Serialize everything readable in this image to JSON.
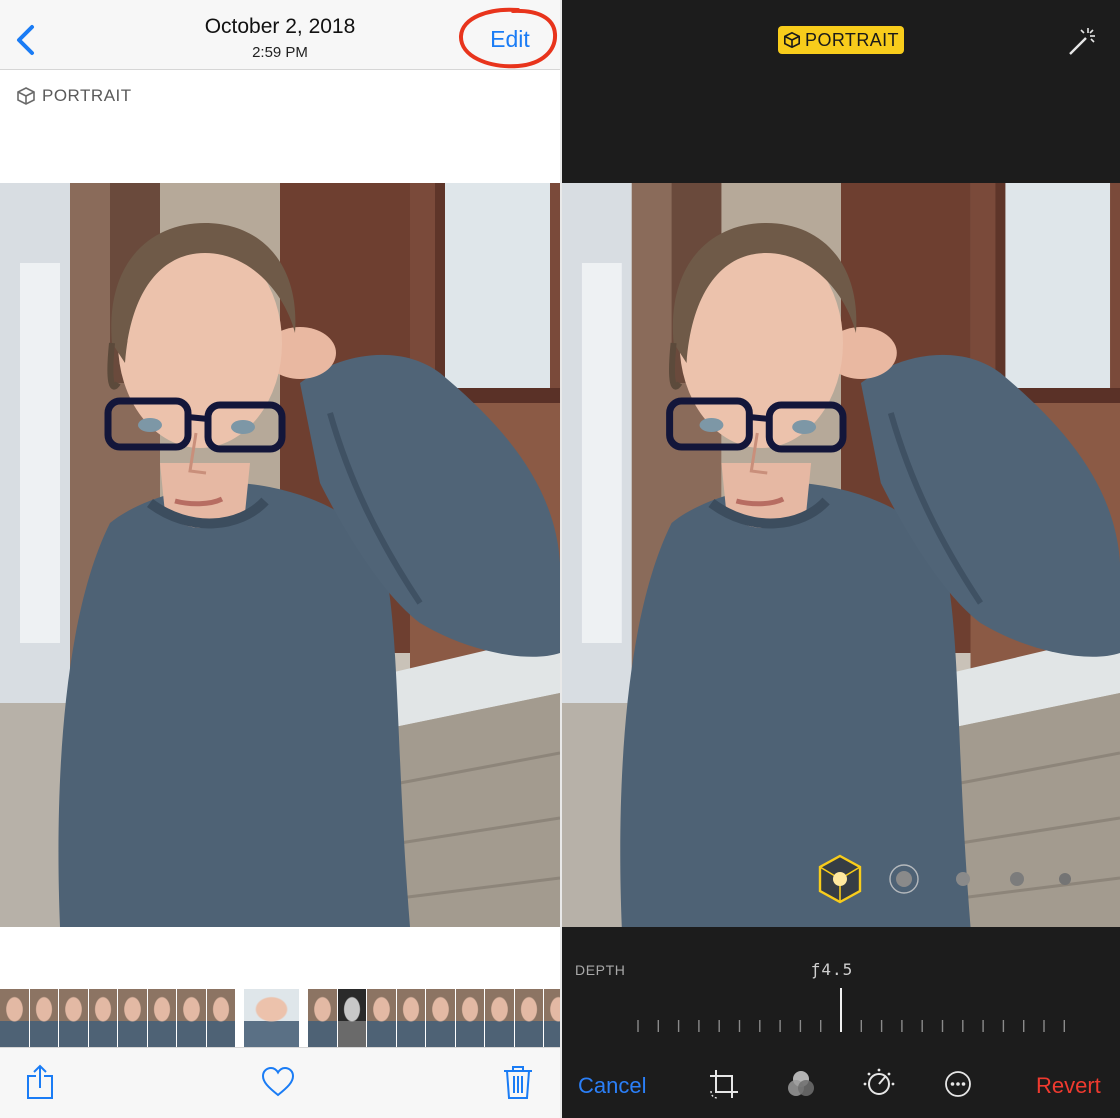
{
  "left_pane": {
    "header": {
      "date": "October 2, 2018",
      "time": "2:59 PM",
      "edit_label": "Edit",
      "accent_color": "#1a7cf5",
      "annotation_color": "#e8341c"
    },
    "portrait_label": "PORTRAIT",
    "filmstrip": {
      "thumbnails": [
        "portrait",
        "portrait",
        "portrait",
        "portrait",
        "portrait",
        "portrait",
        "portrait",
        "portrait",
        "selected-portrait",
        "portrait",
        "bw-portrait",
        "portrait",
        "portrait",
        "portrait",
        "portrait",
        "portrait",
        "portrait",
        "portrait"
      ]
    },
    "toolbar": {
      "icons": [
        "share-icon",
        "heart-icon",
        "trash-icon"
      ]
    }
  },
  "right_pane": {
    "badge_label": "PORTRAIT",
    "badge_color": "#f8cc1b",
    "lighting_options": [
      "natural-light-icon",
      "studio-light-icon",
      "contour-light-icon",
      "stage-light-icon",
      "stage-light-mono-icon"
    ],
    "depth": {
      "label": "DEPTH",
      "value": "ƒ4.5"
    },
    "bottom_bar": {
      "cancel_label": "Cancel",
      "revert_label": "Revert",
      "cancel_color": "#2b7ff7",
      "revert_color": "#ef3a2f",
      "tools": [
        "crop-rotate-icon",
        "filters-icon",
        "adjust-dial-icon",
        "more-icon"
      ]
    }
  }
}
